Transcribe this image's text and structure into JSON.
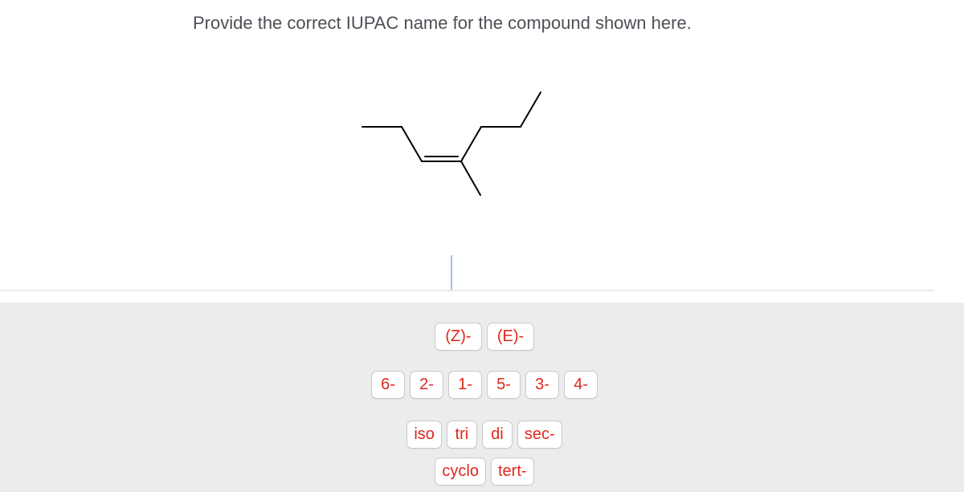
{
  "question": {
    "text": "Provide the correct IUPAC name for the compound shown here."
  },
  "molecule": {
    "description": "skeletal structure: hept-3-ene with methyl on C4 (double bond, branch)",
    "bonds": 8
  },
  "answer": {
    "value": ""
  },
  "palette": {
    "stereo": [
      {
        "label": "(Z)-"
      },
      {
        "label": "(E)-"
      }
    ],
    "locants": [
      {
        "label": "6-"
      },
      {
        "label": "2-"
      },
      {
        "label": "1-"
      },
      {
        "label": "5-"
      },
      {
        "label": "3-"
      },
      {
        "label": "4-"
      }
    ],
    "prefixes": [
      {
        "label": "iso"
      },
      {
        "label": "tri"
      },
      {
        "label": "di"
      },
      {
        "label": "sec-"
      }
    ],
    "misc": [
      {
        "label": "cyclo"
      },
      {
        "label": "tert-"
      }
    ]
  },
  "colors": {
    "chip_text": "#e0271b",
    "palette_bg": "#ececec",
    "caret": "#a6c3dc"
  }
}
